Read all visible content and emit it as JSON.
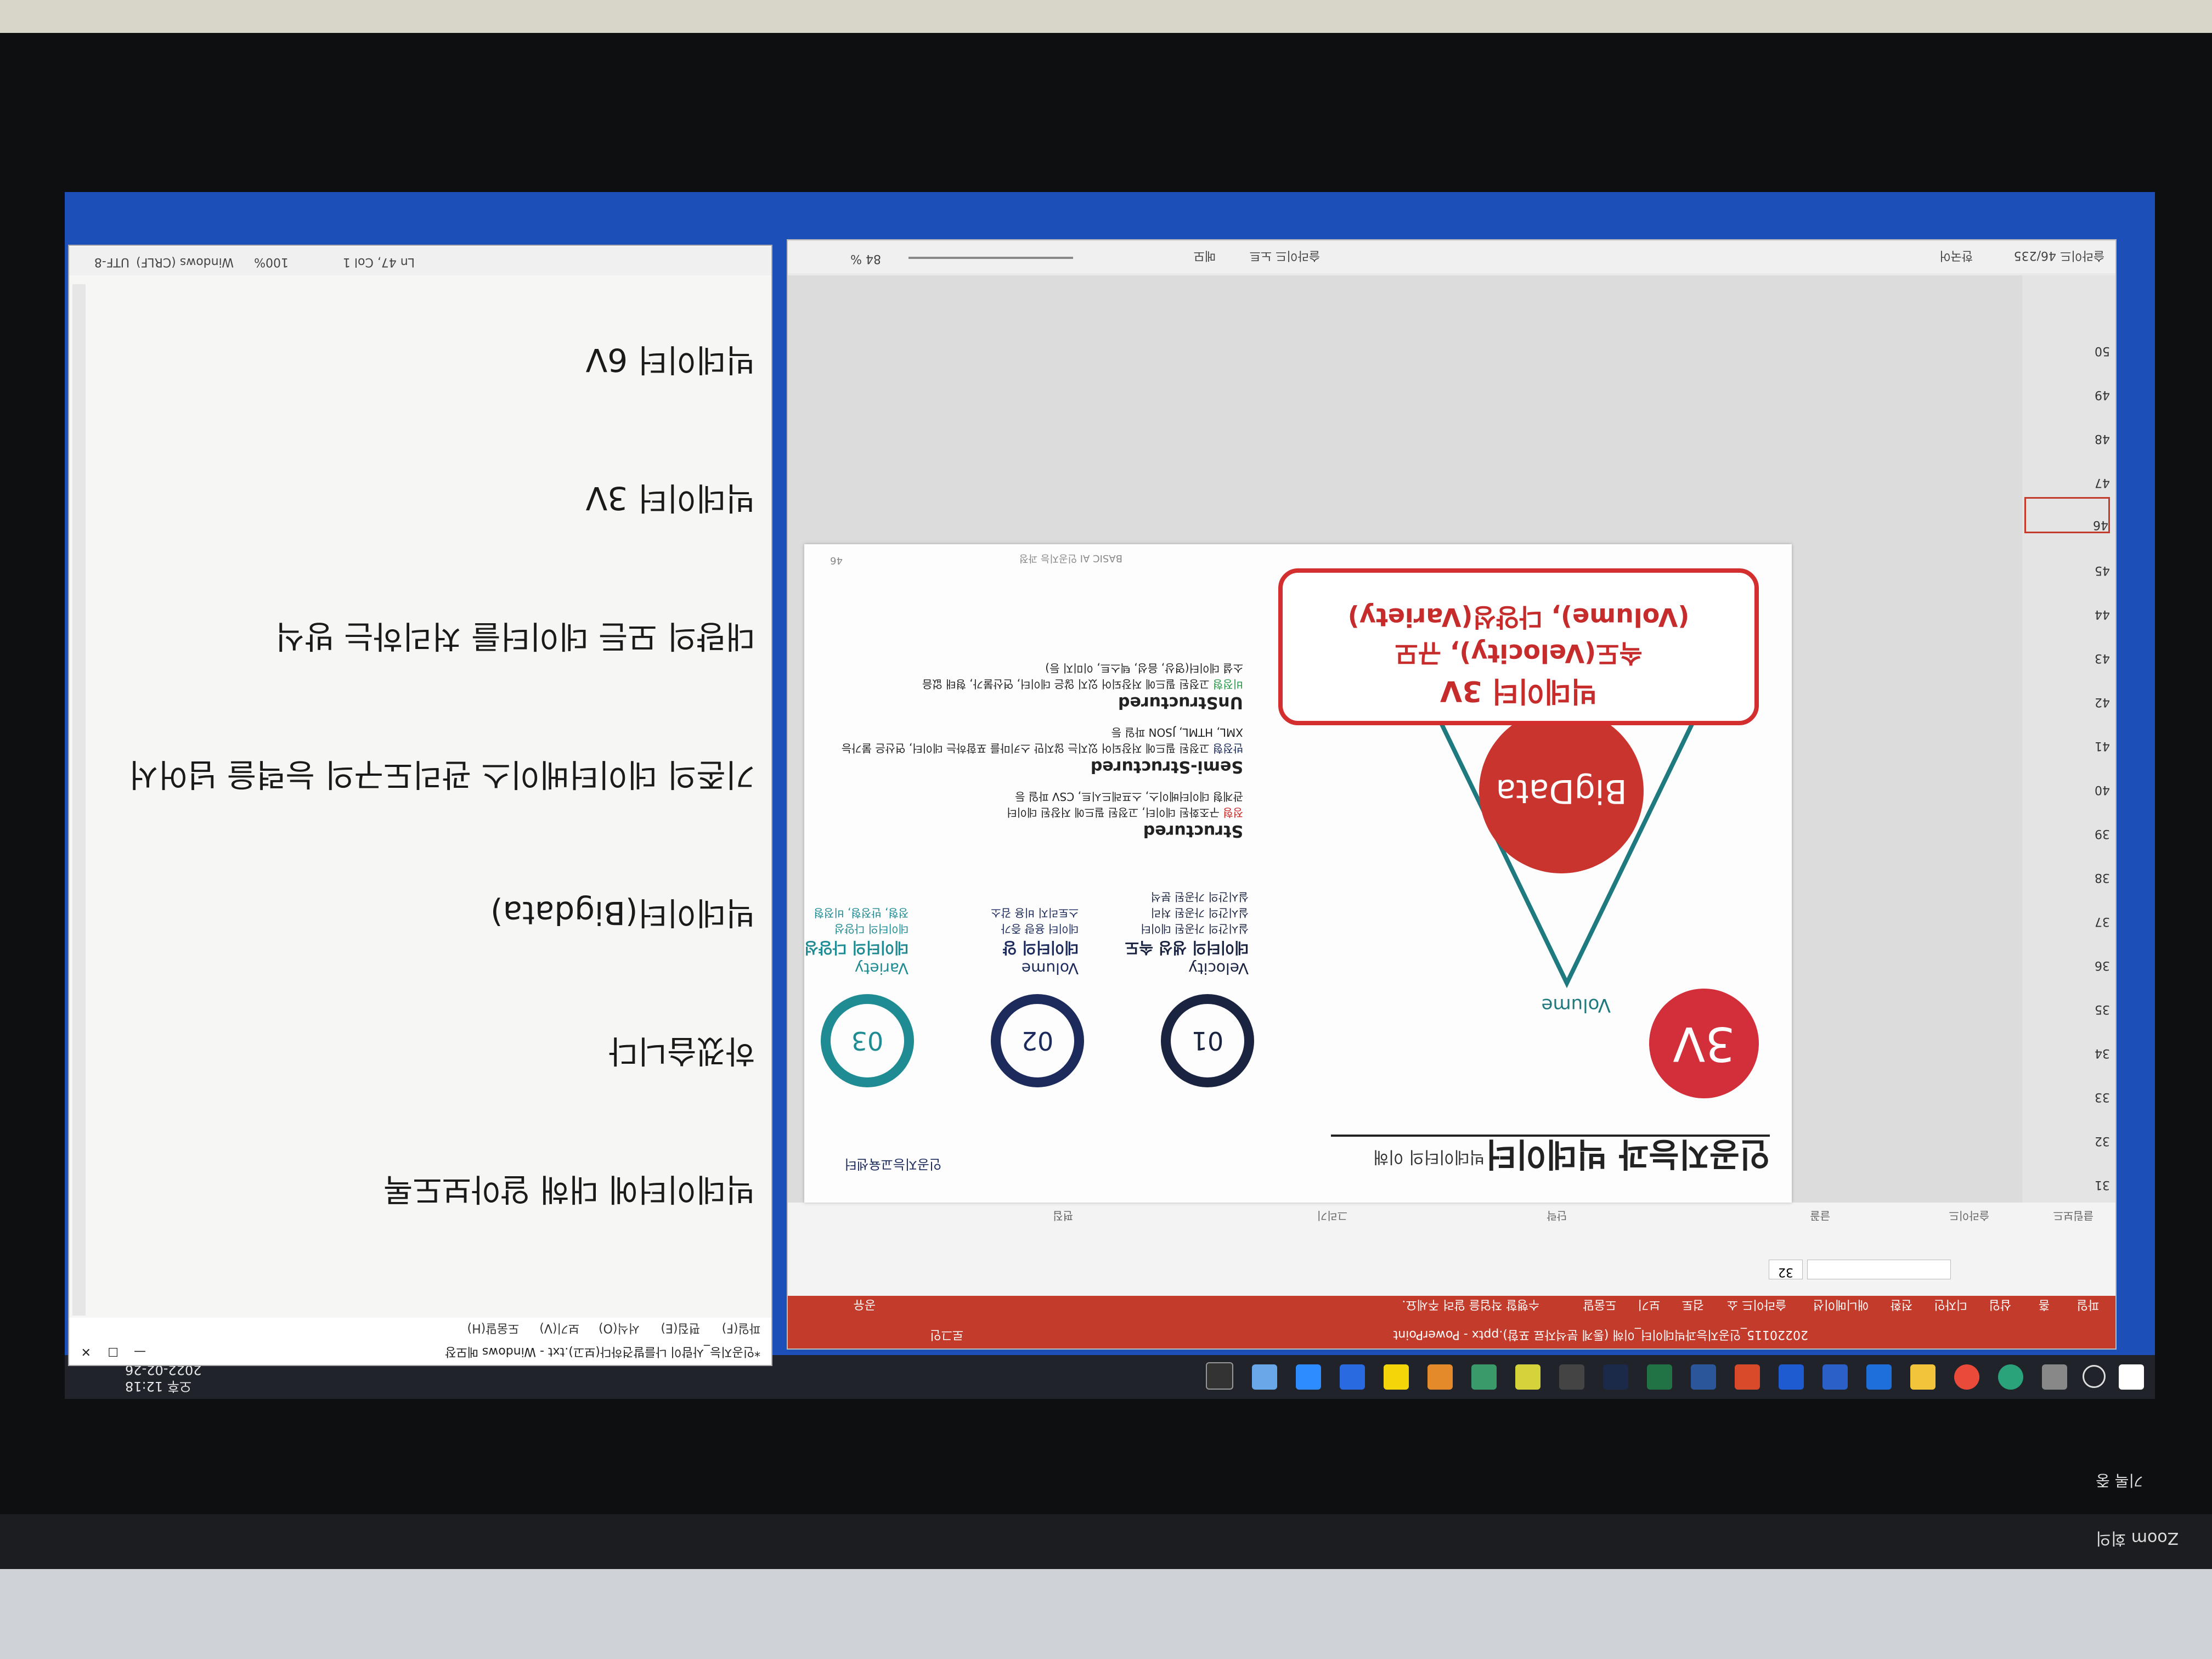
{
  "taskbar": {
    "clock_time": "오후 12:18",
    "clock_date": "2022-02-26"
  },
  "powerpoint": {
    "title": "20220115_인공지능과빅데이터_이해 (통계 분석자료 포함).pptx - PowerPoint",
    "tabs": [
      "파일",
      "홈",
      "삽입",
      "디자인",
      "전환",
      "애니메이션",
      "슬라이드 쇼",
      "검토",
      "보기",
      "도움말"
    ],
    "search_hint": "수행할 작업을 알려 주세요.",
    "share_label": "공유",
    "signin_label": "로그인",
    "ribbon_groups": [
      "클립보드",
      "슬라이드",
      "글꼴",
      "단락",
      "그리기",
      "편집"
    ],
    "font_size": "32",
    "slide_numbers": [
      "31",
      "32",
      "33",
      "34",
      "35",
      "36",
      "37",
      "38",
      "39",
      "40",
      "41",
      "42",
      "43",
      "44",
      "45",
      "46",
      "47",
      "48",
      "49",
      "50"
    ],
    "status_slide": "슬라이드 46/235",
    "status_lang": "한국어",
    "status_notes": "슬라이드 노트",
    "status_comments": "메모",
    "status_zoom": "84 %"
  },
  "slide": {
    "title": "인공지능과 빅데이터",
    "subtitle": "빅데이터의 이해",
    "logo_text": "인공지능교육센터",
    "badge_3v": "3V",
    "funnel_label": "Volume",
    "circle_label": "BigData",
    "callout_line1": "빅데이터 3V",
    "callout_line2": "속도(Velocity), 규모",
    "callout_line3": "(Volume), 다양성(Variety)",
    "items": [
      {
        "num": "01",
        "en": "Velocity",
        "ko": "데이터의 생성 속도",
        "bullets": [
          "실시간의 가공된 데이터",
          "실시간의 가공된 처리",
          "실시간의 가공된 분석"
        ]
      },
      {
        "num": "02",
        "en": "Volume",
        "ko": "데이터의 양",
        "bullets": [
          "데이터 용량 증가",
          "스토리지 비용 감소"
        ]
      },
      {
        "num": "03",
        "en": "Variety",
        "ko": "데이터의 다양성",
        "bullets": [
          "데이터의 다양성",
          "정형, 반정형, 비정형"
        ]
      }
    ],
    "types": [
      {
        "en": "Structured",
        "ko": "정형",
        "desc1": "구조화된 데이터, 고정된 필드에 저장된 데이터",
        "desc2": "관계형 데이터베이스, 스프레드시트, CSV 파일 등"
      },
      {
        "en": "Semi-Structured",
        "ko": "반정형",
        "desc1": "고정된 필드에 저장되어 있지는 않지만 스키마를 포함하는 데이터, 연산은 불가능",
        "desc2": "XML, HTML, JSON 파일 등"
      },
      {
        "en": "UnStructured",
        "ko": "비정형",
        "desc1": "고정된 필드에 저장되어 있지 않은 데이터, 연산불가, 형태 없음",
        "desc2": "소셜 데이터(영상, 음성, 텍스트, 이미지 등)"
      }
    ],
    "footer": "BASIC AI 인공지능 과정",
    "page": "46"
  },
  "notepad": {
    "title": "*인공지능_사람이 나를발견하다(보고).txt - Windows 메모장",
    "menu": [
      "파일(F)",
      "편집(E)",
      "서식(O)",
      "보기(V)",
      "도움말(H)"
    ],
    "lines": [
      "빅데이터에 대해 알아보도록",
      "하겠습니다",
      "빅데이터(Bigdata)",
      "기존의 데이터베이스 관리도구의 능력을 넘어서",
      "대량의 모든 데이터를 처리하는 방식",
      "빅데이터 3V",
      "빅데이터 6V"
    ],
    "status_pos": "Ln 47, Col 1",
    "status_zoom": "100%",
    "status_eol": "Windows (CRLF)",
    "status_enc": "UTF-8"
  },
  "zoom_app": {
    "label": "Zoom 회의",
    "record_label": "기록 중"
  },
  "colors": {
    "accent_red": "#c72c2c",
    "navy": "#1c2a5c",
    "teal": "#1f8c93",
    "ppt_red": "#c33b2a",
    "desktop_blue": "#1d4fb8"
  }
}
